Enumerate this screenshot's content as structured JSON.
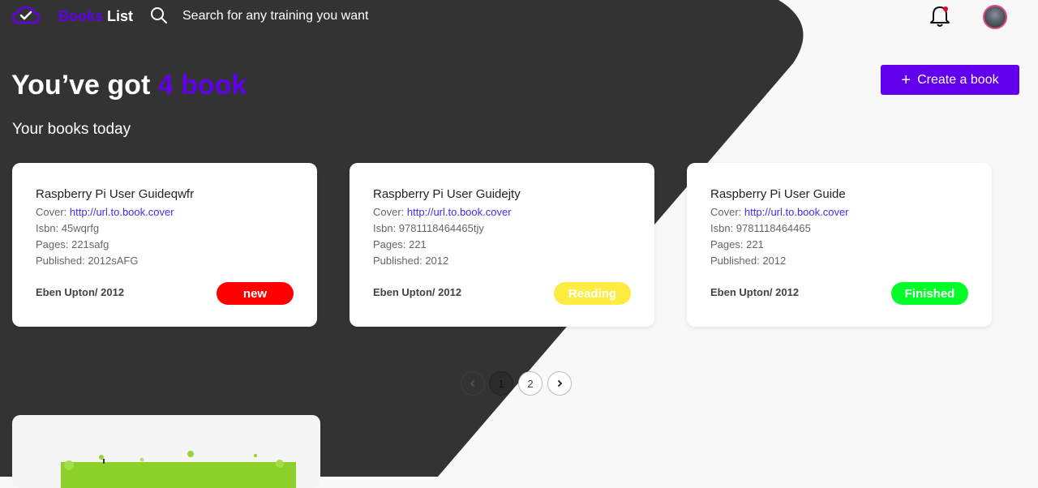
{
  "theme": {
    "accent": "#6200ee",
    "dark": "#333333",
    "light": "#f8f8f8"
  },
  "header": {
    "logo_icon": "cloud-check-icon",
    "brand_part1": "Books",
    "brand_part2": "List",
    "search_icon": "search-icon",
    "search_placeholder": "Search for any training you want",
    "notification_icon": "bell-icon",
    "has_notification": true
  },
  "main": {
    "headline_prefix": "You’ve got",
    "headline_count": "4 book",
    "subheading": "Your books today",
    "create_button": {
      "icon": "plus-icon",
      "label": "Create a book"
    }
  },
  "books": [
    {
      "title": "Raspberry Pi User Guideqwfr",
      "cover_label": "Cover:",
      "cover_url": "http://url.to.book.cover",
      "isbn": "Isbn: 45wqrfg",
      "pages": "Pages: 221safg",
      "published": "Published: 2012sAFG",
      "author": "Eben Upton/ 2012",
      "status": "new",
      "status_color": "#ff0000"
    },
    {
      "title": "Raspberry Pi User Guidejty",
      "cover_label": "Cover:",
      "cover_url": "http://url.to.book.cover",
      "isbn": "Isbn: 9781118464465tjy",
      "pages": "Pages: 221",
      "published": "Published: 2012",
      "author": "Eben Upton/ 2012",
      "status": "Reading",
      "status_color": "#ffec43"
    },
    {
      "title": "Raspberry Pi User Guide",
      "cover_label": "Cover:",
      "cover_url": "http://url.to.book.cover",
      "isbn": "Isbn: 9781118464465",
      "pages": "Pages: 221",
      "published": "Published: 2012",
      "author": "Eben Upton/ 2012",
      "status": "Finished",
      "status_color": "#00ff29"
    }
  ],
  "pagination": {
    "prev_icon": "chevron-left-icon",
    "pages": [
      "1",
      "2"
    ],
    "current": "1",
    "next_icon": "chevron-right-icon"
  }
}
